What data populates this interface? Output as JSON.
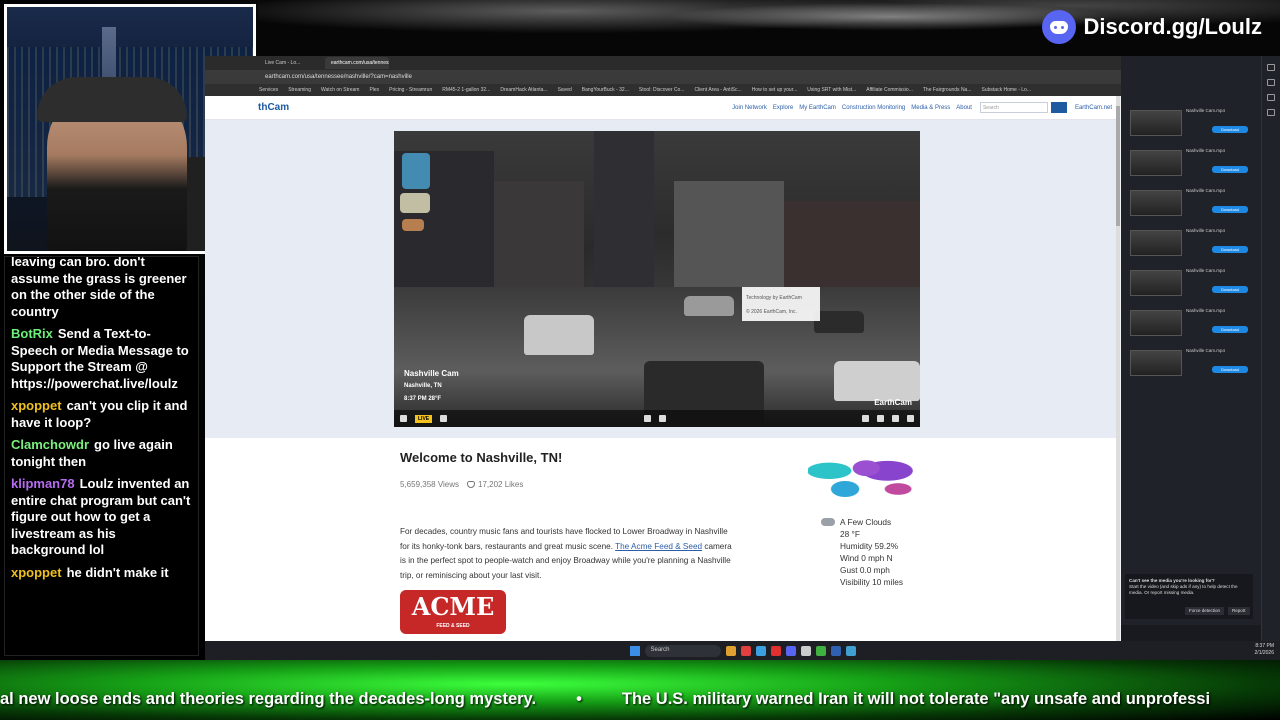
{
  "overlay": {
    "discord_text": "Discord.gg/Loulz"
  },
  "chat": {
    "messages": [
      {
        "user": "",
        "user_color": "#ffffff",
        "text": "leaving can bro. don't assume the grass is greener on the other side of the country"
      },
      {
        "user": "BotRix",
        "user_color": "#6cf07a",
        "text": "Send a Text-to-Speech or Media Message to Support the Stream @ https://powerchat.live/loulz"
      },
      {
        "user": "xpoppet",
        "user_color": "#f0c020",
        "text": "can't you clip it and have it loop?"
      },
      {
        "user": "Clamchowdr",
        "user_color": "#7cf07c",
        "text": "go live again tonight then"
      },
      {
        "user": "klipman78",
        "user_color": "#b46cf0",
        "text": "Loulz invented an entire chat program but can't figure out how to get a livestream as his background lol"
      },
      {
        "user": "xpoppet",
        "user_color": "#f0c020",
        "text": "he didn't make it"
      }
    ]
  },
  "browser": {
    "url": "earthcam.com/usa/tennessee/nashville/?cam=nashville",
    "tabs": [
      "Live Cam - Lo...",
      "earthcam.com/usa/tennessee/n..."
    ],
    "bookmarks": [
      "Services",
      "Streaming",
      "Watch on Stream",
      "Plex",
      "Pricing - Streamrun",
      "RM45-2 1-gallon 32...",
      "DreamHack Atlanta...",
      "Saved",
      "BangYourBuck - 32...",
      "Stool: Discover Co...",
      "Client Area - AntiSc...",
      "How to set up your...",
      "Using SRT with Mist...",
      "Affiliate Commissio...",
      "The Fairgrounds Na...",
      "Substack Home - Lo..."
    ]
  },
  "earthcam": {
    "logo": "thCam",
    "nav": [
      "Join Network",
      "Explore",
      "My EarthCam",
      "Construction Monitoring",
      "Media & Press",
      "About"
    ],
    "search_placeholder": "Search",
    "net_link": "EarthCam.net",
    "video": {
      "cam_name": "Nashville Cam",
      "location": "Nashville, TN",
      "time_temp": "8:37 PM    28°F",
      "tech_line1": "Technology by EarthCam",
      "tech_line2": "© 2026 EarthCam, Inc.",
      "live_label": "LIVE",
      "badge": "EarthCam"
    },
    "welcome_title": "Welcome to Nashville, TN!",
    "views": "5,659,358 Views",
    "likes": "17,202 Likes",
    "desc_before": "For decades, country music fans and tourists have flocked to Lower Broadway in Nashville for its honky-tonk bars, restaurants and great music scene.",
    "desc_link": "The Acme Feed & Seed",
    "desc_after": "camera is in the perfect spot to people-watch and enjoy Broadway while you're planning a Nashville trip, or reminiscing about your last visit.",
    "weather": [
      "A Few Clouds",
      "28 °F",
      "Humidity 59.2%",
      "Wind 0 mph N",
      "Gust 0.0 mph",
      "Visibility 10 miles"
    ],
    "acme_logo": "ACME",
    "acme_sub": "FEED & SEED"
  },
  "sidebar": {
    "items": [
      {
        "name": "Nashville Cam.mp4",
        "button": "Download"
      },
      {
        "name": "Nashville Cam.mp4",
        "button": "Download"
      },
      {
        "name": "Nashville Cam.mp4",
        "button": "Download"
      },
      {
        "name": "Nashville Cam.mp4",
        "button": "Download"
      },
      {
        "name": "Nashville Cam.mp4",
        "button": "Download"
      },
      {
        "name": "Nashville Cam.mp4",
        "button": "Download"
      },
      {
        "name": "Nashville Cam.mp4",
        "button": "Download"
      }
    ],
    "popup_title": "Can't see the media you're looking for?",
    "popup_text": "Start the video (and skip ads if any) to help detect the media. Or report missing media.",
    "popup_btn1": "Force detection",
    "popup_btn2": "Report"
  },
  "taskbar": {
    "search": "Search",
    "time": "8:37 PM",
    "date": "2/1/2026"
  },
  "ticker": {
    "item1": "al new loose ends and theories regarding the decades-long mystery.",
    "separator": "•",
    "item2": "The U.S. military warned Iran it will not tolerate \"any unsafe and unprofessi"
  }
}
